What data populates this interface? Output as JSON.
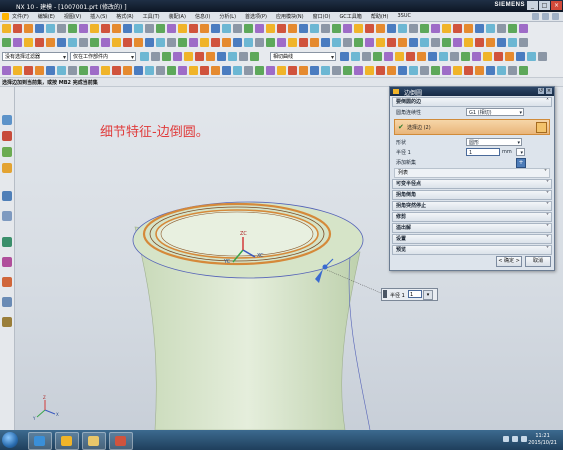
{
  "window": {
    "title": "NX 10 - 建模 - [1007001.prt (修改的) ]",
    "brand": "SIEMENS"
  },
  "menu": {
    "items": [
      "文件(F)",
      "编辑(E)",
      "视图(V)",
      "插入(S)",
      "格式(R)",
      "工具(T)",
      "装配(A)",
      "信息(I)",
      "分析(L)",
      "首选项(P)",
      "应用模块(N)",
      "窗口(O)",
      "GC工具箱",
      "帮助(H)",
      "3SUC"
    ]
  },
  "filter_bar": {
    "type_filter": "没有选择过滤器",
    "scope_filter": "仅在工作部件内",
    "snap_filter": "相切曲线"
  },
  "status": {
    "prompt": "选择边加到当前集，或按 MB2 完成当前集"
  },
  "annotation": {
    "text": "细节特征-边倒圆。"
  },
  "dialog": {
    "title": "边倒圆",
    "section_edge": "要倒圆的边",
    "continuity_label": "圆角连续性",
    "continuity_value": "G1 (相切)",
    "select_edges": "选择边 (2)",
    "shape_label": "形状",
    "shape_value": "圆形",
    "radius_label": "半径 1",
    "radius_value": "1",
    "radius_unit": "mm",
    "add_new_set": "添加新集",
    "list_label": "列表",
    "sections": [
      "可变半径点",
      "拐角倒角",
      "拐角突然停止",
      "修剪",
      "溢出解",
      "设置",
      "预览"
    ],
    "ok": "< 确定 >",
    "cancel": "取消"
  },
  "radius_tag": {
    "label": "半径 1",
    "value": "1"
  },
  "taskbar": {
    "time": "11:21",
    "date": "2015/10/21"
  }
}
